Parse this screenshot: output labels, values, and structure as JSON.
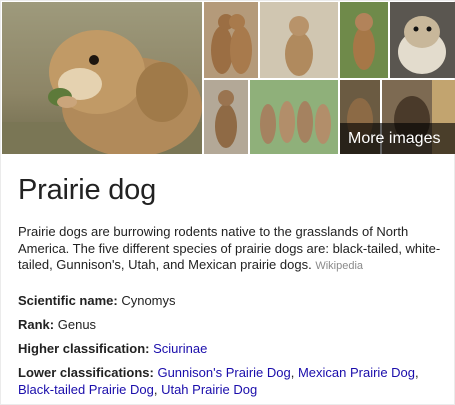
{
  "images": {
    "more_label": "More images",
    "tiles": [
      {
        "name": "prairie-dog-eating-photo"
      },
      {
        "name": "prairie-dogs-kissing-photo"
      },
      {
        "name": "prairie-dog-standing-photo"
      },
      {
        "name": "prairie-dog-standing-grass-photo"
      },
      {
        "name": "prairie-dog-closeup-photo"
      },
      {
        "name": "prairie-dog-rock-photo"
      },
      {
        "name": "prairie-dogs-group-photo"
      },
      {
        "name": "prairie-dogs-pair-photo"
      },
      {
        "name": "prairie-dog-dark-photo"
      }
    ]
  },
  "title": "Prairie dog",
  "description": {
    "text": "Prairie dogs are burrowing rodents native to the grasslands of North America. The five different species of prairie dogs are: black-tailed, white-tailed, Gunnison's, Utah, and Mexican prairie dogs.",
    "source": "Wikipedia"
  },
  "facts": {
    "scientific_name": {
      "label": "Scientific name:",
      "value": "Cynomys"
    },
    "rank": {
      "label": "Rank:",
      "value": "Genus"
    },
    "higher_classification": {
      "label": "Higher classification:",
      "value": "Sciurinae"
    },
    "lower_classifications": {
      "label": "Lower classifications:",
      "items": [
        "Gunnison's Prairie Dog",
        "Mexican Prairie Dog",
        "Black-tailed Prairie Dog",
        "Utah Prairie Dog"
      ],
      "separator": ", "
    }
  },
  "colors": {
    "link": "#1a0dab",
    "source": "#8a8a8a",
    "text": "#222222"
  }
}
